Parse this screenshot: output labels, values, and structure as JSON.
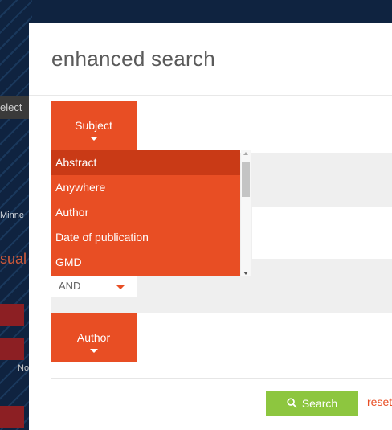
{
  "background": {
    "row_select": "elect",
    "row_minne": "Minne",
    "row_ual": "sual",
    "row_no": "No"
  },
  "modal": {
    "title": "enhanced search",
    "field1": {
      "label": "Subject",
      "value": ""
    },
    "dropdown": {
      "items": [
        "Abstract",
        "Anywhere",
        "Author",
        "Date of publication",
        "GMD"
      ],
      "highlighted": "Abstract"
    },
    "field2": {
      "value": ""
    },
    "operator": {
      "selected": "AND"
    },
    "field3": {
      "label": "Author",
      "value": ""
    },
    "search_label": "Search",
    "reset_label": "reset"
  },
  "colors": {
    "accent": "#e84e24",
    "search_button": "#8dc63f"
  }
}
